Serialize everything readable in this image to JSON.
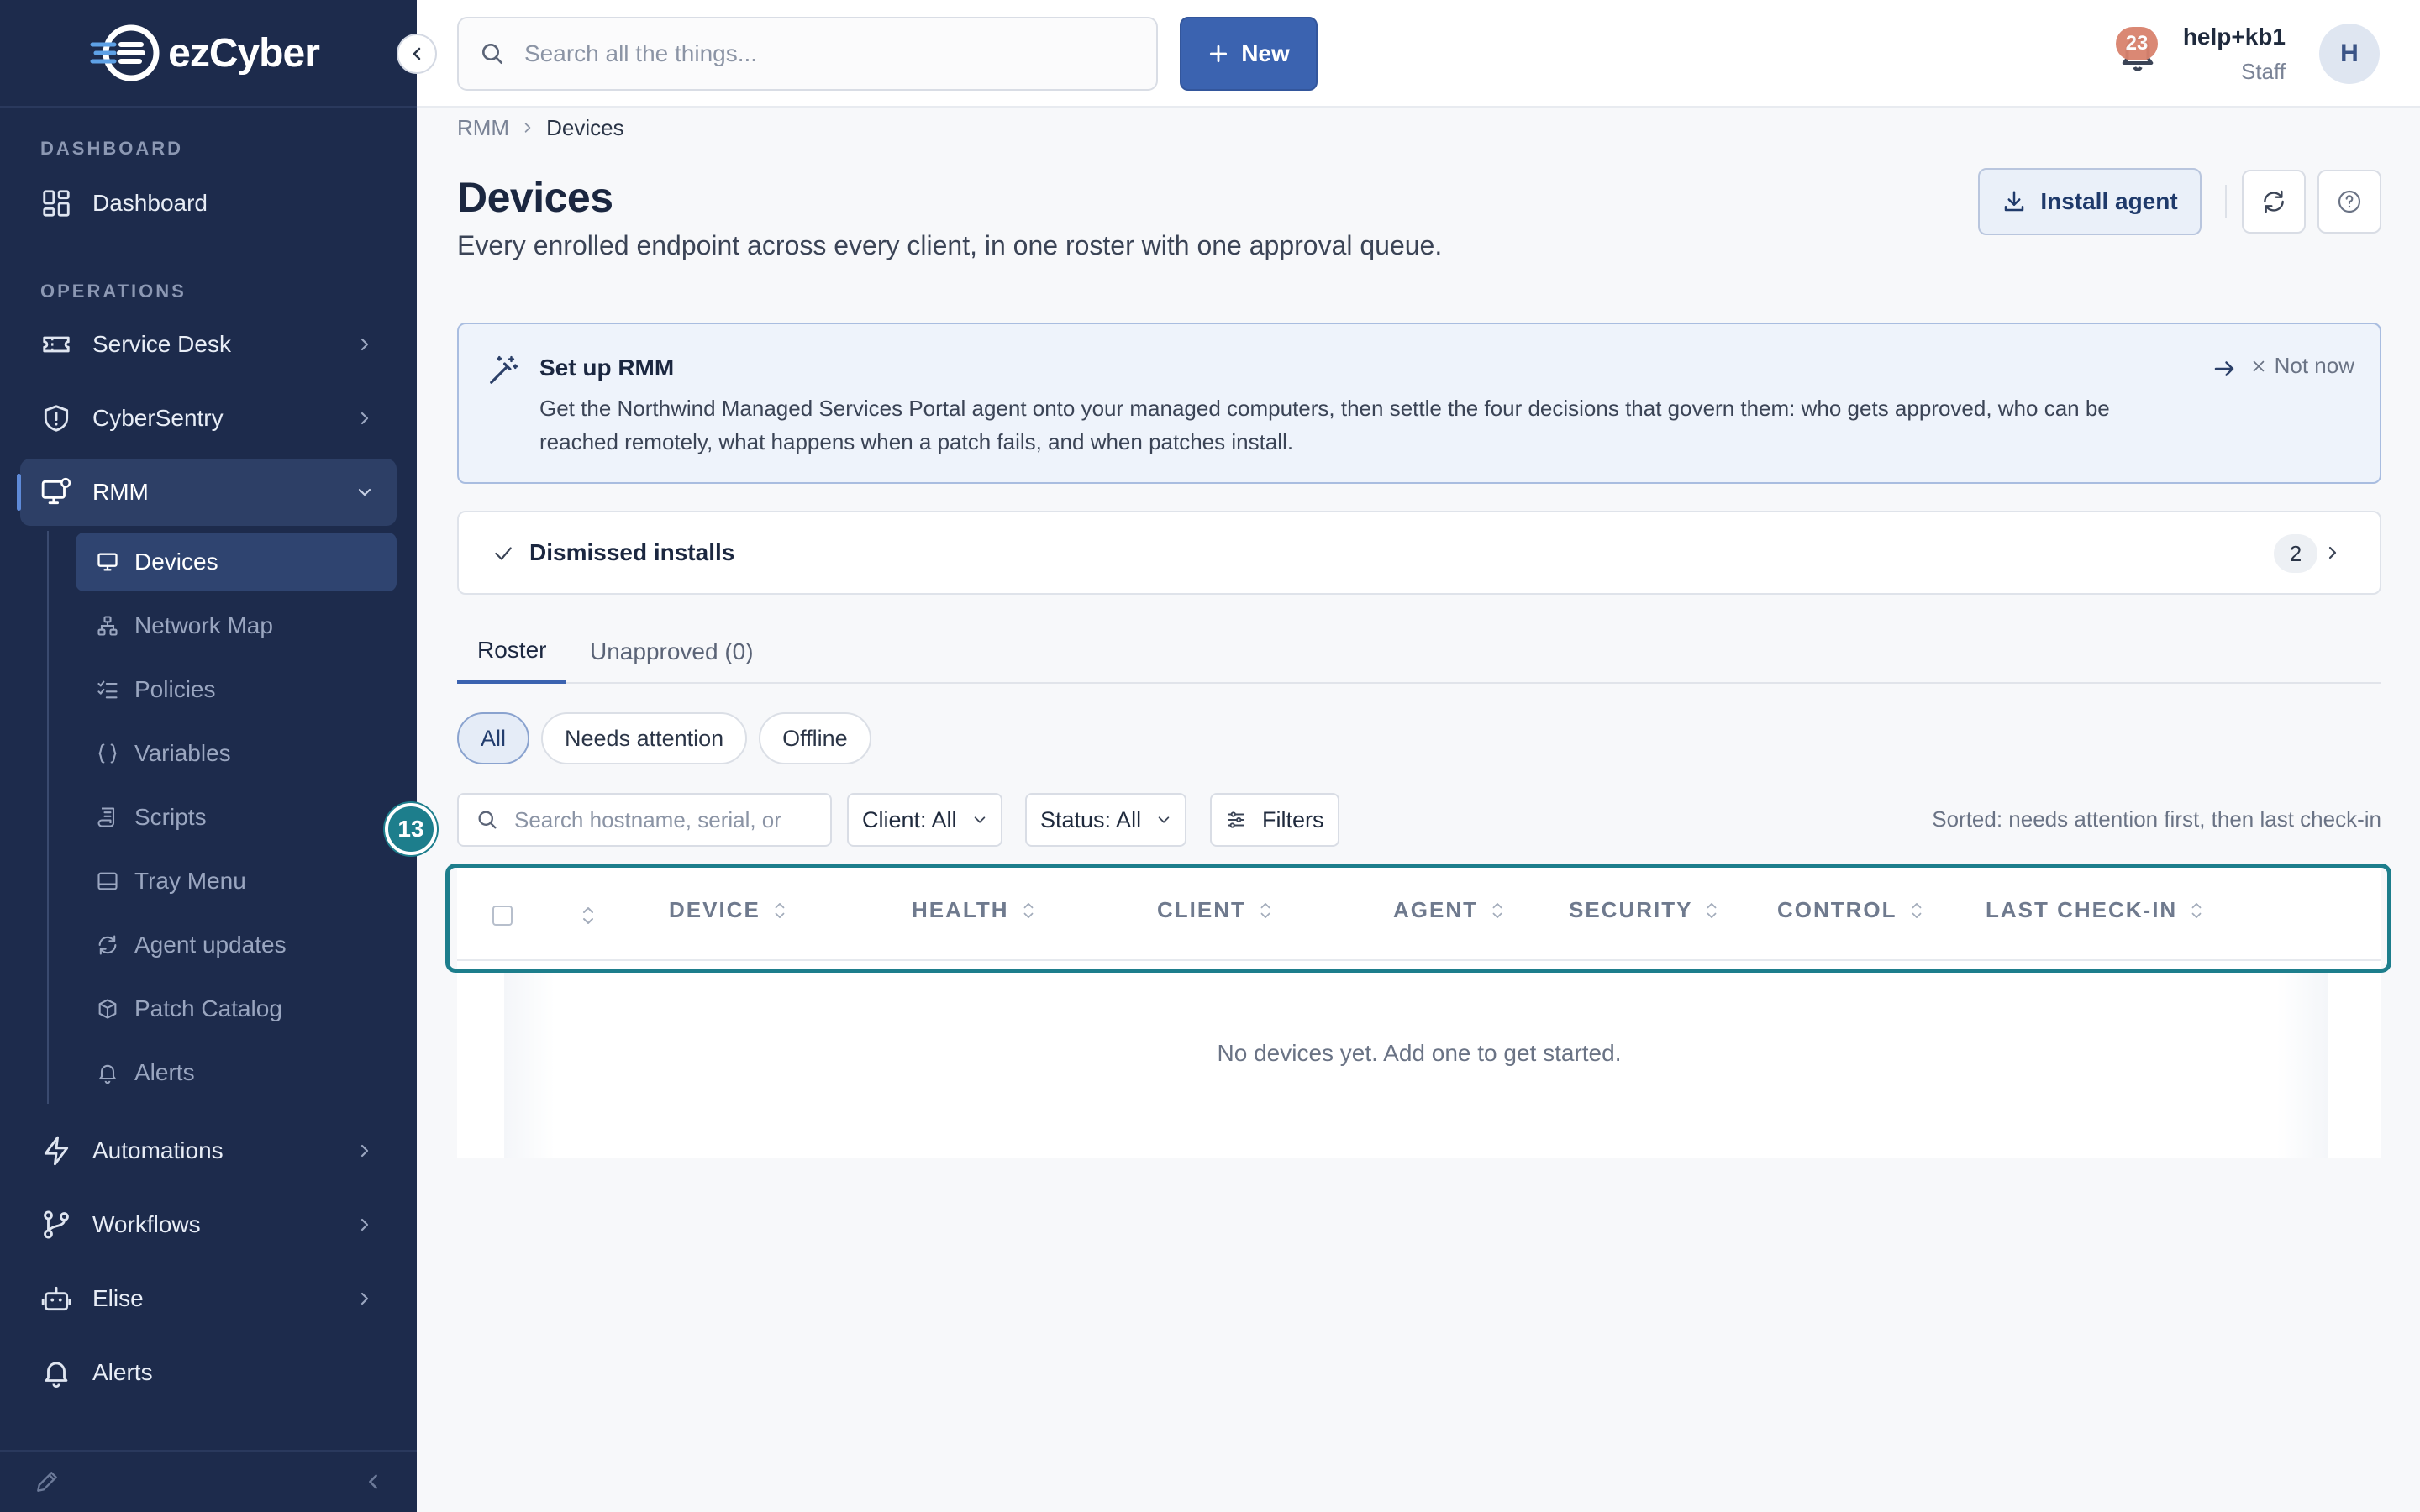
{
  "app": {
    "logo_text": "ezCyber"
  },
  "sidebar": {
    "sections": [
      {
        "label": "DASHBOARD"
      },
      {
        "label": "OPERATIONS"
      }
    ],
    "items": [
      {
        "label": "Dashboard",
        "icon": "dashboard-grid-icon"
      },
      {
        "label": "Service Desk",
        "icon": "ticket-icon"
      },
      {
        "label": "CyberSentry",
        "icon": "shield-icon"
      },
      {
        "label": "RMM",
        "icon": "monitor-settings-icon",
        "expanded": true
      },
      {
        "label": "Automations",
        "icon": "lightning-icon"
      },
      {
        "label": "Workflows",
        "icon": "branch-icon"
      },
      {
        "label": "Elise",
        "icon": "robot-icon"
      },
      {
        "label": "Alerts",
        "icon": "bell-icon"
      }
    ],
    "rmm_sub_items": [
      {
        "label": "Devices",
        "icon": "monitor-icon",
        "active": true
      },
      {
        "label": "Network Map",
        "icon": "network-icon"
      },
      {
        "label": "Policies",
        "icon": "list-check-icon"
      },
      {
        "label": "Variables",
        "icon": "braces-icon"
      },
      {
        "label": "Scripts",
        "icon": "script-icon"
      },
      {
        "label": "Tray Menu",
        "icon": "tray-icon"
      },
      {
        "label": "Agent updates",
        "icon": "refresh-icon"
      },
      {
        "label": "Patch Catalog",
        "icon": "package-icon"
      },
      {
        "label": "Alerts",
        "icon": "bell-icon"
      }
    ]
  },
  "topbar": {
    "search_placeholder": "Search all the things...",
    "new_label": "New",
    "notification_count": "23",
    "user_name": "help+kb1",
    "user_role": "Staff",
    "avatar_initial": "H"
  },
  "breadcrumb": [
    "RMM",
    "Devices"
  ],
  "page": {
    "title": "Devices",
    "subtitle": "Every enrolled endpoint across every client, in one roster with one approval queue.",
    "install_agent_label": "Install agent"
  },
  "setup_card": {
    "title": "Set up RMM",
    "body": "Get the Northwind Managed Services Portal agent onto your managed computers, then settle the four decisions that govern them: who gets approved, who can be reached remotely, what happens when a patch fails, and when patches install.",
    "dismiss_label": "Not now"
  },
  "dismissed_installs": {
    "label": "Dismissed installs",
    "count": "2"
  },
  "tabs": [
    {
      "label": "Roster",
      "active": true
    },
    {
      "label": "Unapproved (0)",
      "active": false
    }
  ],
  "chips": [
    {
      "label": "All",
      "active": true
    },
    {
      "label": "Needs attention",
      "active": false
    },
    {
      "label": "Offline",
      "active": false
    }
  ],
  "filters": {
    "search_placeholder": "Search hostname, serial, or",
    "client_label": "Client: All",
    "status_label": "Status: All",
    "filters_label": "Filters",
    "sorted_note": "Sorted: needs attention first, then last check-in"
  },
  "step_badge": "13",
  "table": {
    "columns": [
      "DEVICE",
      "HEALTH",
      "CLIENT",
      "AGENT",
      "SECURITY",
      "CONTROL",
      "LAST CHECK-IN"
    ],
    "empty_message": "No devices yet. Add one to get started."
  },
  "colors": {
    "sidebar_bg": "#1d2b4c",
    "accent": "#3b63b0",
    "highlight": "#1d7e8c"
  }
}
